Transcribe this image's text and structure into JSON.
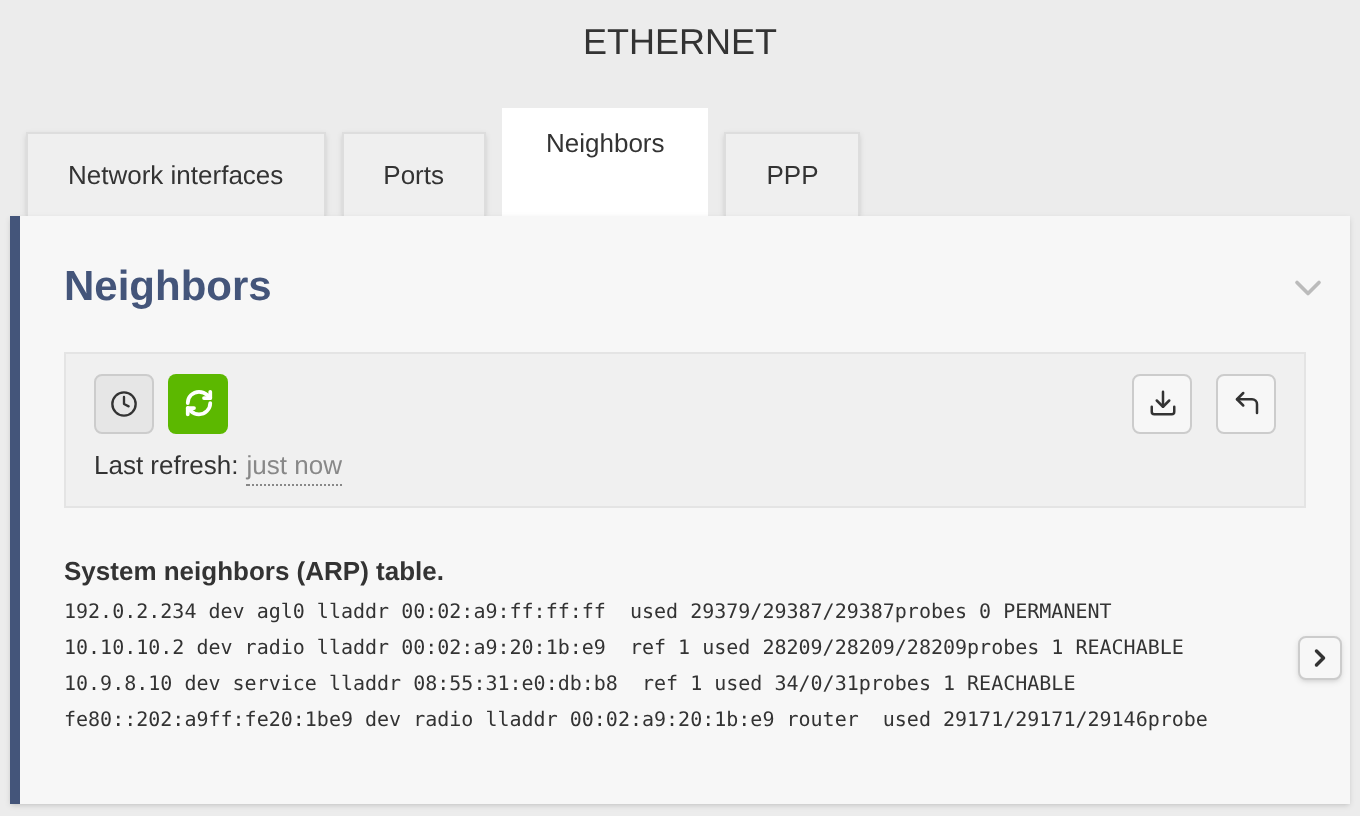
{
  "page_title": "ETHERNET",
  "tabs": [
    {
      "label": "Network interfaces",
      "selected": false
    },
    {
      "label": "Ports",
      "selected": false
    },
    {
      "label": "Neighbors",
      "selected": true
    },
    {
      "label": "PPP",
      "selected": false
    }
  ],
  "section": {
    "title": "Neighbors",
    "expanded": true,
    "toolbar": {
      "last_refresh_label": "Last refresh:",
      "last_refresh_value": "just now"
    },
    "table_title": "System neighbors (ARP) table.",
    "lines": [
      "192.0.2.234 dev agl0 lladdr 00:02:a9:ff:ff:ff  used 29379/29387/29387probes 0 PERMANENT",
      "10.10.10.2 dev radio lladdr 00:02:a9:20:1b:e9  ref 1 used 28209/28209/28209probes 1 REACHABLE",
      "10.9.8.10 dev service lladdr 08:55:31:e0:db:b8  ref 1 used 34/0/31probes 1 REACHABLE",
      "fe80::202:a9ff:fe20:1be9 dev radio lladdr 00:02:a9:20:1b:e9 router  used 29171/29171/29146probe"
    ]
  }
}
